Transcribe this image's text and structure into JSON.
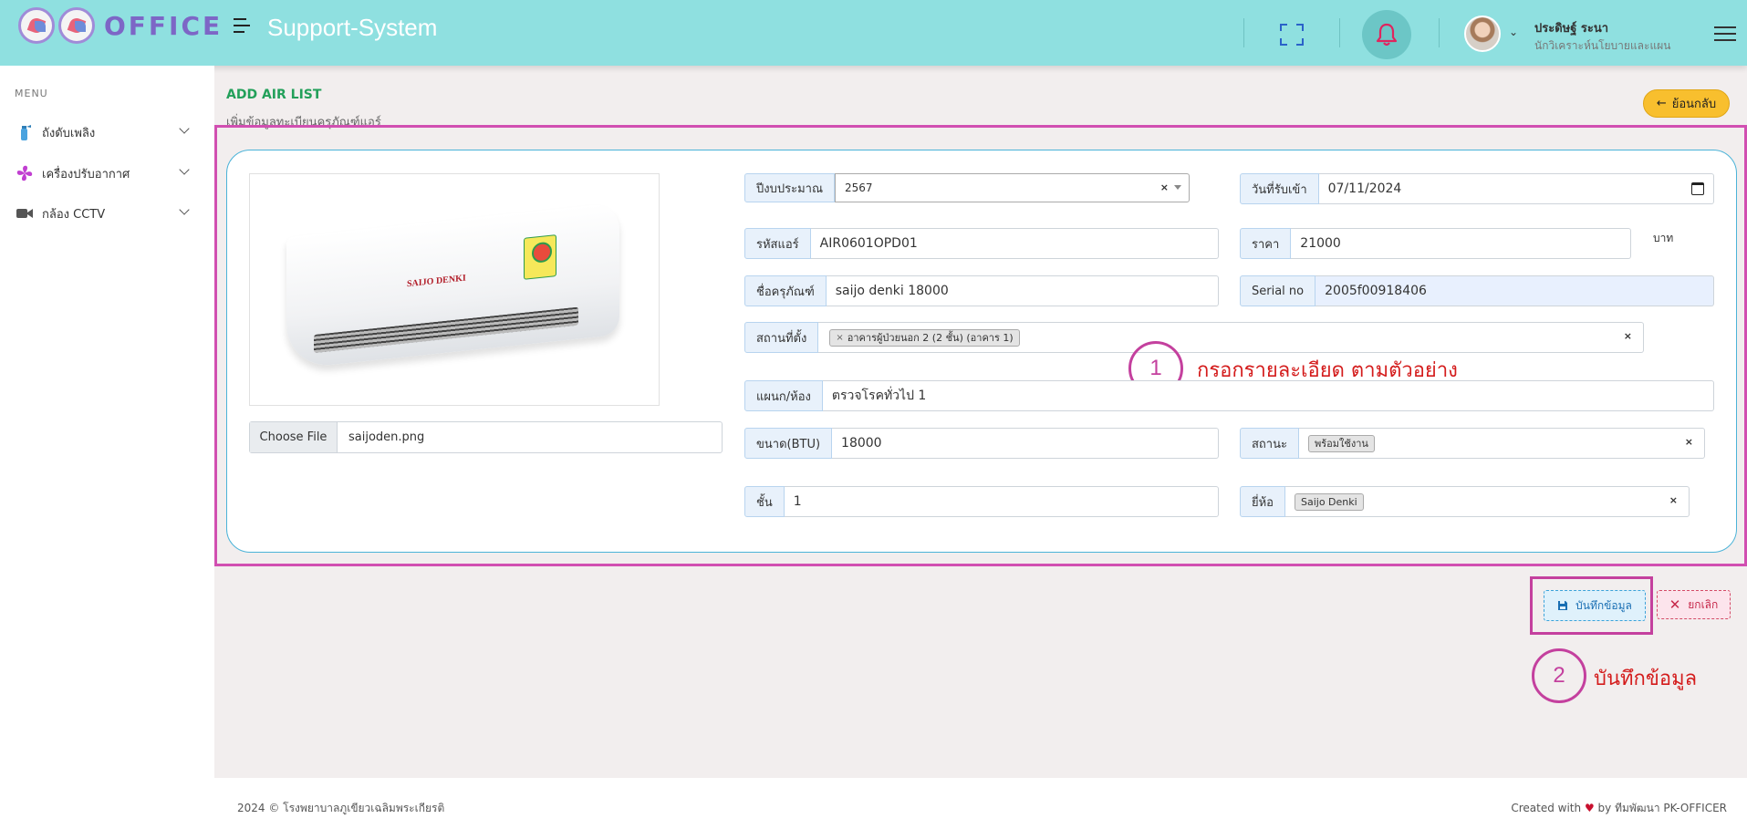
{
  "header": {
    "logo_text": "OFFICE",
    "app_title": "Support-System",
    "user_name": "ประดิษฐ์ ระนา",
    "user_role": "นักวิเคราะห์นโยบายและแผน"
  },
  "sidebar": {
    "menu_label": "MENU",
    "items": [
      {
        "label": "ถังดับเพลิง",
        "icon": "fire-extinguisher-icon"
      },
      {
        "label": "เครื่องปรับอากาศ",
        "icon": "fan-icon"
      },
      {
        "label": "กล้อง CCTV",
        "icon": "video-camera-icon"
      }
    ]
  },
  "page": {
    "title": "ADD AIR LIST",
    "subtitle": "เพิ่มข้อมูลทะเบียนครุภัณฑ์แอร์",
    "back_label": "ย้อนกลับ"
  },
  "form": {
    "image_brand": "SAIJO DENKI",
    "file_button": "Choose File",
    "file_name": "saijoden.png",
    "budget_year": {
      "label": "ปีงบประมาณ",
      "value": "2567"
    },
    "receive_date": {
      "label": "วันที่รับเข้า",
      "value": "07/11/2024"
    },
    "air_code": {
      "label": "รหัสแอร์",
      "value": "AIR0601OPD01"
    },
    "price": {
      "label": "ราคา",
      "value": "21000",
      "unit": "บาท"
    },
    "equipment_name": {
      "label": "ชื่อครุภัณฑ์",
      "value": "saijo denki 18000"
    },
    "serial_no": {
      "label": "Serial no",
      "value": "2005f00918406"
    },
    "location": {
      "label": "สถานที่ตั้ง",
      "value": "อาคารผู้ป่วยนอก 2 (2 ชั้น) (อาคาร 1)"
    },
    "department": {
      "label": "แผนก/ห้อง",
      "value": "ตรวจโรคทั่วไป 1"
    },
    "btu": {
      "label": "ขนาด(BTU)",
      "value": "18000"
    },
    "status": {
      "label": "สถานะ",
      "value": "พร้อมใช้งาน"
    },
    "floor": {
      "label": "ชั้น",
      "value": "1"
    },
    "brand": {
      "label": "ยี่ห้อ",
      "value": "Saijo Denki"
    },
    "clear_symbol": "×"
  },
  "annotations": {
    "step1_number": "1",
    "step1_text": "กรอกรายละเอียด ตามตัวอย่าง",
    "step2_number": "2",
    "step2_text": "บันทึกข้อมูล"
  },
  "actions": {
    "save_label": "บันทึกข้อมูล",
    "cancel_label": "ยกเลิก"
  },
  "footer": {
    "left": "2024 © โรงพยาบาลภูเขียวเฉลิมพระเกียรติ",
    "right_prefix": "Created with",
    "right_suffix": "by ทีมพัฒนา PK-OFFICER"
  },
  "colors": {
    "header_bg": "#8fe0e0",
    "accent_green": "#23a05a",
    "highlight": "#c4409e",
    "annotation_red": "#d41c1c",
    "back_button": "#f8bf2e"
  }
}
